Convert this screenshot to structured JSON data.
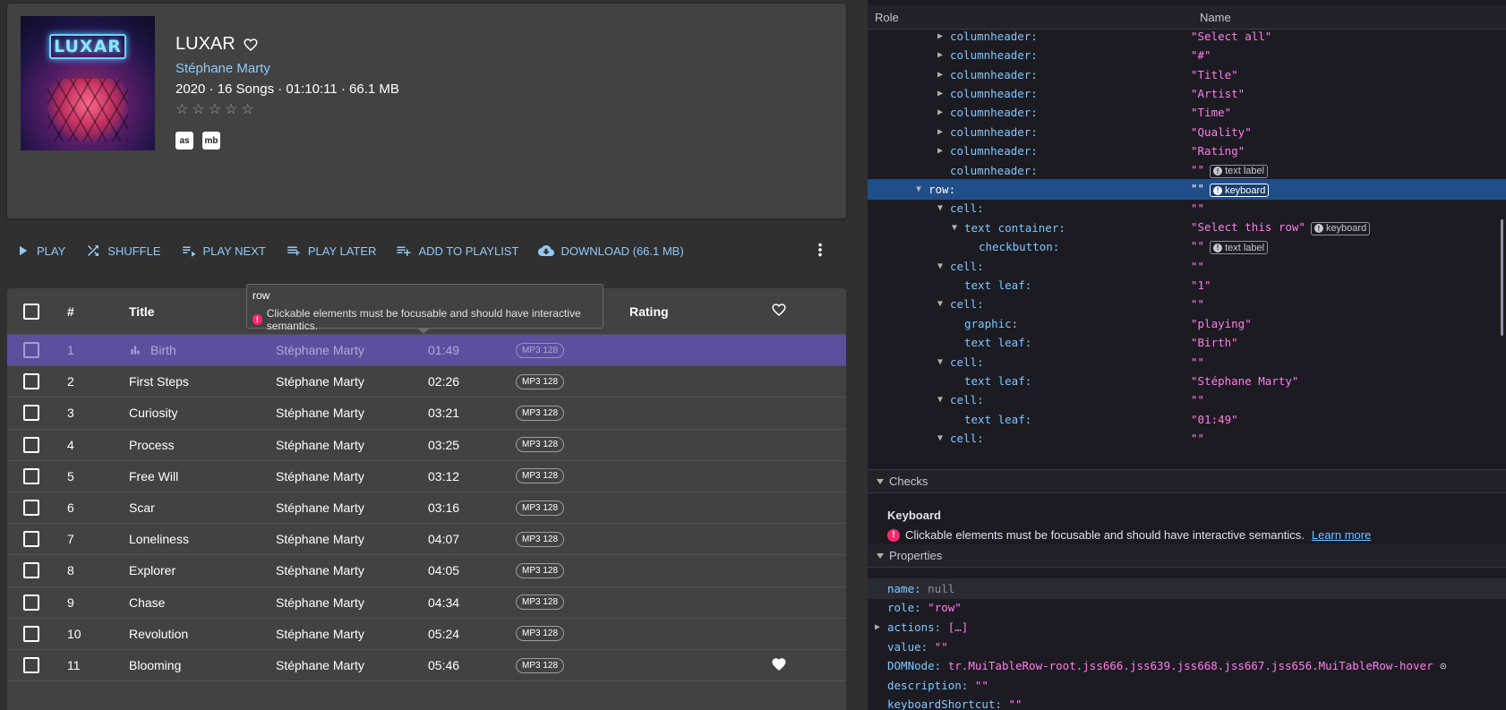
{
  "album": {
    "cover_text": "LUXAR",
    "title": "LUXAR",
    "artist": "Stéphane Marty",
    "meta": "2020 · 16 Songs · 01:10:11 · 66.1 MB",
    "stars": "☆☆☆☆☆",
    "lastfm_label": "as",
    "musicbrainz_label": "mb"
  },
  "toolbar": {
    "play": "PLAY",
    "shuffle": "SHUFFLE",
    "play_next": "PLAY NEXT",
    "play_later": "PLAY LATER",
    "add_to_playlist": "ADD TO PLAYLIST",
    "download": "DOWNLOAD (66.1 MB)"
  },
  "table": {
    "headers": {
      "num": "#",
      "title": "Title",
      "rating": "Rating"
    },
    "rows": [
      {
        "num": "1",
        "title": "Birth",
        "artist": "Stéphane Marty",
        "time": "01:49",
        "quality": "MP3 128",
        "playing": true,
        "loved": false
      },
      {
        "num": "2",
        "title": "First Steps",
        "artist": "Stéphane Marty",
        "time": "02:26",
        "quality": "MP3 128",
        "playing": false,
        "loved": false
      },
      {
        "num": "3",
        "title": "Curiosity",
        "artist": "Stéphane Marty",
        "time": "03:21",
        "quality": "MP3 128",
        "playing": false,
        "loved": false
      },
      {
        "num": "4",
        "title": "Process",
        "artist": "Stéphane Marty",
        "time": "03:25",
        "quality": "MP3 128",
        "playing": false,
        "loved": false
      },
      {
        "num": "5",
        "title": "Free Will",
        "artist": "Stéphane Marty",
        "time": "03:12",
        "quality": "MP3 128",
        "playing": false,
        "loved": false
      },
      {
        "num": "6",
        "title": "Scar",
        "artist": "Stéphane Marty",
        "time": "03:16",
        "quality": "MP3 128",
        "playing": false,
        "loved": false
      },
      {
        "num": "7",
        "title": "Loneliness",
        "artist": "Stéphane Marty",
        "time": "04:07",
        "quality": "MP3 128",
        "playing": false,
        "loved": false
      },
      {
        "num": "8",
        "title": "Explorer",
        "artist": "Stéphane Marty",
        "time": "04:05",
        "quality": "MP3 128",
        "playing": false,
        "loved": false
      },
      {
        "num": "9",
        "title": "Chase",
        "artist": "Stéphane Marty",
        "time": "04:34",
        "quality": "MP3 128",
        "playing": false,
        "loved": false
      },
      {
        "num": "10",
        "title": "Revolution",
        "artist": "Stéphane Marty",
        "time": "05:24",
        "quality": "MP3 128",
        "playing": false,
        "loved": false
      },
      {
        "num": "11",
        "title": "Blooming",
        "artist": "Stéphane Marty",
        "time": "05:46",
        "quality": "MP3 128",
        "playing": false,
        "loved": true
      }
    ]
  },
  "tooltip": {
    "role": "row",
    "message": "Clickable elements must be focusable and should have interactive semantics."
  },
  "devtools": {
    "col_role": "Role",
    "col_name": "Name",
    "tree": [
      {
        "role": "columnheader:",
        "name": "\"Select all\"",
        "depth": 1,
        "twisty": "right",
        "badge": null
      },
      {
        "role": "columnheader:",
        "name": "\"#\"",
        "depth": 1,
        "twisty": "right",
        "badge": null
      },
      {
        "role": "columnheader:",
        "name": "\"Title\"",
        "depth": 1,
        "twisty": "right",
        "badge": null
      },
      {
        "role": "columnheader:",
        "name": "\"Artist\"",
        "depth": 1,
        "twisty": "right",
        "badge": null
      },
      {
        "role": "columnheader:",
        "name": "\"Time\"",
        "depth": 1,
        "twisty": "right",
        "badge": null
      },
      {
        "role": "columnheader:",
        "name": "\"Quality\"",
        "depth": 1,
        "twisty": "right",
        "badge": null
      },
      {
        "role": "columnheader:",
        "name": "\"Rating\"",
        "depth": 1,
        "twisty": "right",
        "badge": null
      },
      {
        "role": "columnheader:",
        "name": "\"\"",
        "depth": 1,
        "twisty": "none",
        "badge": "text label"
      },
      {
        "role": "row:",
        "name": "\"\"",
        "depth": 0,
        "twisty": "down",
        "badge": "keyboard",
        "selected": true
      },
      {
        "role": "cell:",
        "name": "\"\"",
        "depth": 1,
        "twisty": "down",
        "badge": null
      },
      {
        "role": "text container:",
        "name": "\"Select this row\"",
        "depth": 2,
        "twisty": "down",
        "badge": "keyboard"
      },
      {
        "role": "checkbutton:",
        "name": "\"\"",
        "depth": 3,
        "twisty": "none",
        "badge": "text label"
      },
      {
        "role": "cell:",
        "name": "\"\"",
        "depth": 1,
        "twisty": "down",
        "badge": null
      },
      {
        "role": "text leaf:",
        "name": "\"1\"",
        "depth": 2,
        "twisty": "none",
        "badge": null
      },
      {
        "role": "cell:",
        "name": "\"\"",
        "depth": 1,
        "twisty": "down",
        "badge": null
      },
      {
        "role": "graphic:",
        "name": "\"playing\"",
        "depth": 2,
        "twisty": "none",
        "badge": null
      },
      {
        "role": "text leaf:",
        "name": "\"Birth\"",
        "depth": 2,
        "twisty": "none",
        "badge": null
      },
      {
        "role": "cell:",
        "name": "\"\"",
        "depth": 1,
        "twisty": "down",
        "badge": null
      },
      {
        "role": "text leaf:",
        "name": "\"Stéphane Marty\"",
        "depth": 2,
        "twisty": "none",
        "badge": null
      },
      {
        "role": "cell:",
        "name": "\"\"",
        "depth": 1,
        "twisty": "down",
        "badge": null
      },
      {
        "role": "text leaf:",
        "name": "\"01:49\"",
        "depth": 2,
        "twisty": "none",
        "badge": null
      },
      {
        "role": "cell:",
        "name": "\"\"",
        "depth": 1,
        "twisty": "down",
        "badge": null
      }
    ],
    "checks": {
      "section": "Checks",
      "title": "Keyboard",
      "message": "Clickable elements must be focusable and should have interactive semantics.",
      "link": "Learn more"
    },
    "properties": {
      "section": "Properties",
      "rows": [
        {
          "key": "name:",
          "value": "null",
          "null": true
        },
        {
          "key": "role:",
          "value": "\"row\""
        },
        {
          "key": "actions:",
          "value": "[…]",
          "expandable": true
        },
        {
          "key": "value:",
          "value": "\"\""
        },
        {
          "key": "DOMNode:",
          "value": "tr.MuiTableRow-root.jss666.jss639.jss668.jss667.jss656.MuiTableRow-hover"
        },
        {
          "key": "description:",
          "value": "\"\""
        },
        {
          "key": "keyboardShortcut:",
          "value": "\"\""
        }
      ]
    }
  }
}
